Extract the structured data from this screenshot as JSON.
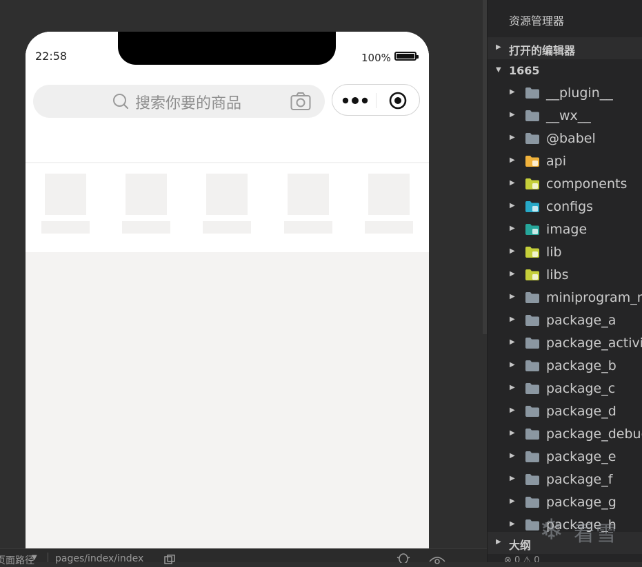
{
  "simulator": {
    "status_time": "22:58",
    "battery_text": "100%",
    "search_placeholder": "搜索你要的商品",
    "category_count": 5
  },
  "bottom_bar": {
    "page_path_label": "页面路径",
    "page_path": "pages/index/index"
  },
  "explorer": {
    "title": "资源管理器",
    "open_editors": "打开的编辑器",
    "project": "1665",
    "items": [
      {
        "name": "__plugin__",
        "icon": "folder-icon",
        "color": "#8b97a1"
      },
      {
        "name": "__wx__",
        "icon": "folder-icon",
        "color": "#8b97a1"
      },
      {
        "name": "@babel",
        "icon": "folder-icon",
        "color": "#8b97a1"
      },
      {
        "name": "api",
        "icon": "folder-api-icon",
        "color": "#f0b23c"
      },
      {
        "name": "components",
        "icon": "folder-components-icon",
        "color": "#c5cf3a"
      },
      {
        "name": "configs",
        "icon": "folder-config-icon",
        "color": "#27a9c8"
      },
      {
        "name": "image",
        "icon": "folder-images-icon",
        "color": "#26a69a"
      },
      {
        "name": "lib",
        "icon": "folder-lib-icon",
        "color": "#c5cf3a"
      },
      {
        "name": "libs",
        "icon": "folder-lib-icon",
        "color": "#c5cf3a"
      },
      {
        "name": "miniprogram_npm",
        "icon": "folder-icon",
        "color": "#8b97a1"
      },
      {
        "name": "package_a",
        "icon": "folder-icon",
        "color": "#8b97a1"
      },
      {
        "name": "package_activity",
        "icon": "folder-icon",
        "color": "#8b97a1"
      },
      {
        "name": "package_b",
        "icon": "folder-icon",
        "color": "#8b97a1"
      },
      {
        "name": "package_c",
        "icon": "folder-icon",
        "color": "#8b97a1"
      },
      {
        "name": "package_d",
        "icon": "folder-icon",
        "color": "#8b97a1"
      },
      {
        "name": "package_debug",
        "icon": "folder-icon",
        "color": "#8b97a1"
      },
      {
        "name": "package_e",
        "icon": "folder-icon",
        "color": "#8b97a1"
      },
      {
        "name": "package_f",
        "icon": "folder-icon",
        "color": "#8b97a1"
      },
      {
        "name": "package_g",
        "icon": "folder-icon",
        "color": "#8b97a1"
      },
      {
        "name": "package_h",
        "icon": "folder-icon",
        "color": "#8b97a1"
      }
    ],
    "outline": "大纲",
    "counters": "⊗ 0 ⚠ 0"
  },
  "watermark": {
    "text": "看雪"
  }
}
